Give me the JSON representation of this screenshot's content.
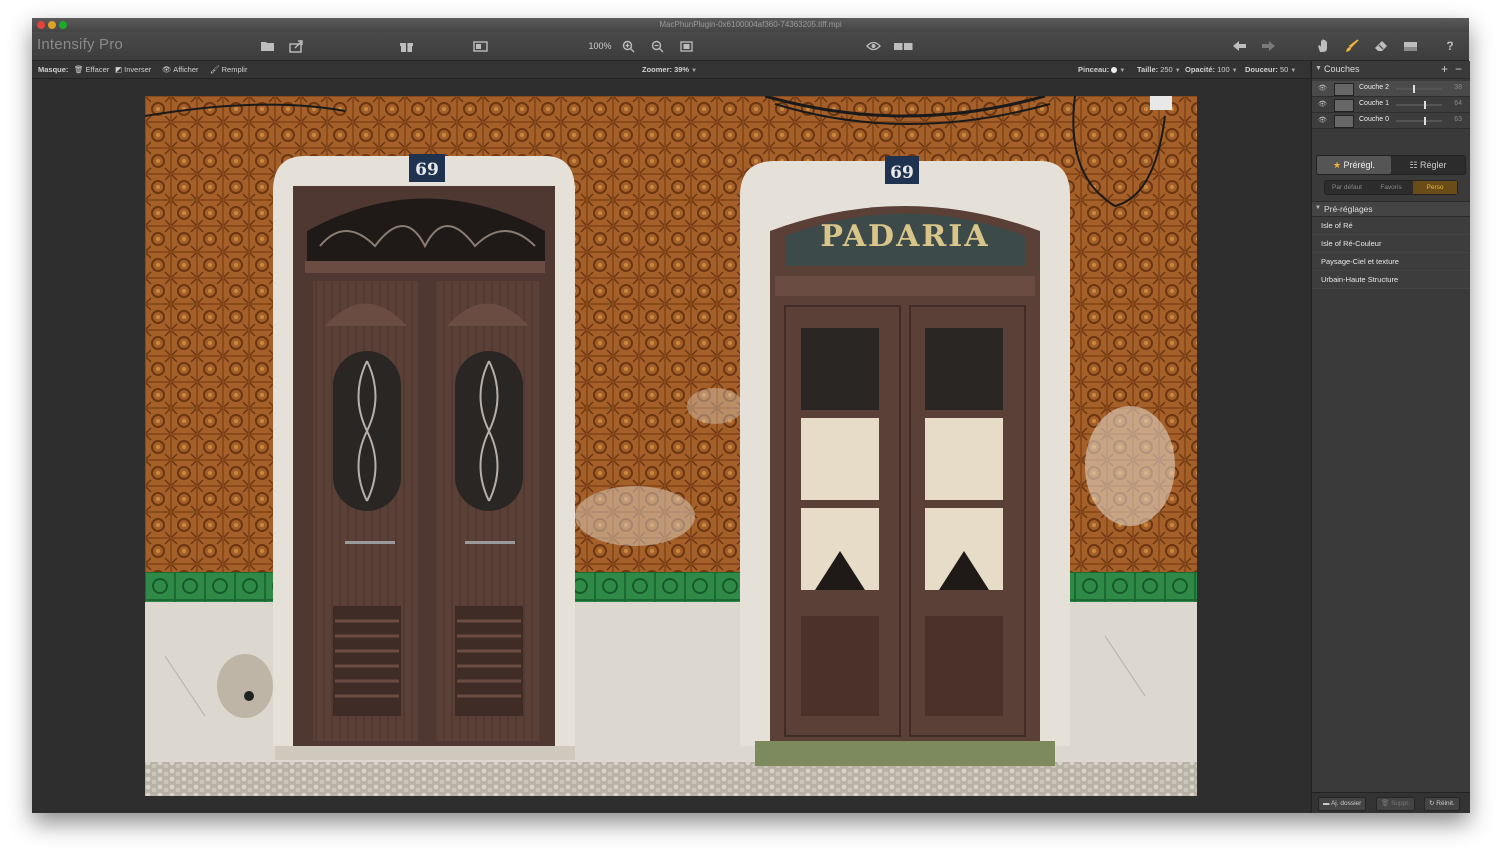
{
  "window": {
    "title": "MacPhunPlugin-0x6100004af360-74363205.tiff.mpi"
  },
  "toolbar": {
    "app_name": "Intensify Pro",
    "zoom_percent": "100%",
    "icons": [
      "open-icon",
      "share-icon",
      "gift-icon",
      "compare-icon",
      "zoom-in-icon",
      "zoom-out-icon",
      "fit-icon",
      "preview-eye-icon",
      "split-view-icon",
      "undo-icon",
      "redo-icon",
      "hand-tool-icon",
      "brush-tool-icon",
      "eraser-tool-icon",
      "gradient-tool-icon",
      "help-icon"
    ]
  },
  "options": {
    "mask_label": "Masque:",
    "effacer": "Effacer",
    "inverser": "Inverser",
    "afficher": "Afficher",
    "remplir": "Remplir",
    "zoom_label": "Zoomer:",
    "zoom_value": "39%",
    "brush_label": "Pinceau:",
    "size_label": "Taille:",
    "size_value": "250",
    "opacity_label": "Opacité:",
    "opacity_value": "100",
    "softness_label": "Douceur:",
    "softness_value": "50"
  },
  "photo": {
    "left_number": "69",
    "right_number": "69",
    "sign_text": "PADARIA"
  },
  "panel": {
    "layers_title": "Couches",
    "layers": [
      {
        "name": "Couche 2",
        "value": "38",
        "selected": true,
        "level": 0.38
      },
      {
        "name": "Couche 1",
        "value": "64",
        "selected": false,
        "level": 0.64
      },
      {
        "name": "Couche 0",
        "value": "63",
        "selected": false,
        "level": 0.63
      }
    ],
    "tab_presets": "Prérégl.",
    "tab_adjust": "Régler",
    "subtabs": [
      "Par défaut",
      "Favoris",
      "Perso"
    ],
    "presets_title": "Pré-réglages",
    "presets": [
      "Isle of Ré",
      "Isle of Ré-Couleur",
      "Paysage-Ciel et texture",
      "Urbain-Haute Structure"
    ],
    "footer": {
      "add_folder": "Aj. dossier",
      "delete": "Suppr.",
      "reset": "Réinit."
    }
  },
  "colors": {
    "accent": "#f0b43a",
    "tile": "#8a4a1c",
    "door": "#5b4038"
  }
}
